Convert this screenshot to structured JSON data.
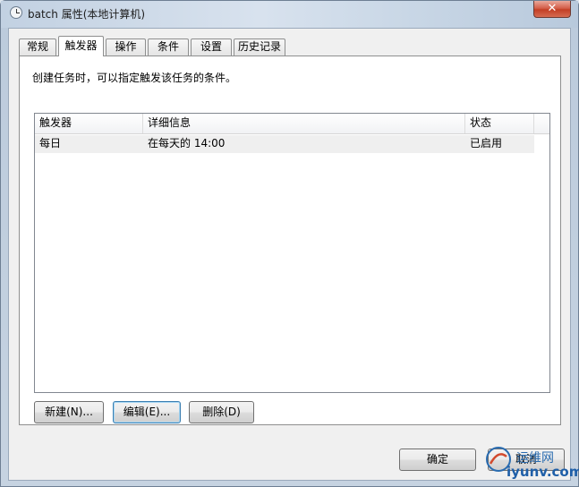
{
  "window": {
    "title": "batch 属性(本地计算机)",
    "close_glyph": "✕"
  },
  "tabs": [
    {
      "label": "常规"
    },
    {
      "label": "触发器",
      "active": true
    },
    {
      "label": "操作"
    },
    {
      "label": "条件"
    },
    {
      "label": "设置"
    },
    {
      "label": "历史记录"
    }
  ],
  "panel": {
    "description": "创建任务时，可以指定触发该任务的条件。"
  },
  "list": {
    "columns": [
      "触发器",
      "详细信息",
      "状态"
    ],
    "rows": [
      {
        "trigger": "每日",
        "details": "在每天的 14:00",
        "status": "已启用"
      }
    ]
  },
  "buttons": {
    "new": "新建(N)...",
    "edit": "编辑(E)...",
    "delete": "删除(D)"
  },
  "footer": {
    "ok": "确定",
    "cancel": "取消"
  },
  "watermark": {
    "line1": "运维网",
    "line2": "iyunv.com"
  },
  "colors": {
    "titlebar": "#c2d1e2",
    "close": "#c33f25",
    "row_bg": "#efefef",
    "focus": "#3c7fb1"
  }
}
